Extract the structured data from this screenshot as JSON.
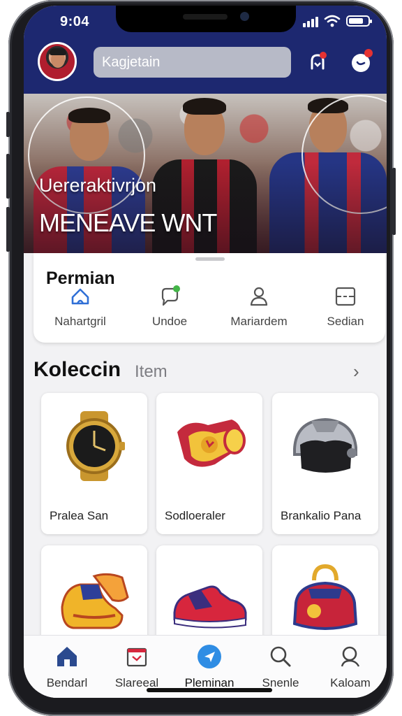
{
  "status": {
    "time": "9:04"
  },
  "header": {
    "search_value": "Kagjetain",
    "icons": [
      "avatar",
      "notification-icon",
      "chat-icon"
    ]
  },
  "hero": {
    "subtitle": "Uereraktivrjon",
    "title": "MENEAVE WNT"
  },
  "panel": {
    "title": "Permian",
    "items": [
      {
        "label": "Nahartgril",
        "icon": "home-outline-icon"
      },
      {
        "label": "Undoe",
        "icon": "chat-bubble-icon"
      },
      {
        "label": "Mariardem",
        "icon": "person-icon"
      },
      {
        "label": "Sedian",
        "icon": "ticket-icon"
      }
    ]
  },
  "collection": {
    "title": "Koleccin",
    "subtitle": "Item",
    "arrow": "›",
    "items": [
      {
        "label": "Pralea San",
        "icon": "watch-icon"
      },
      {
        "label": "Sodloeraler",
        "icon": "scroll-icon"
      },
      {
        "label": "Brankalio Pana",
        "icon": "helmet-icon"
      },
      {
        "label": "",
        "icon": "boots-icon"
      },
      {
        "label": "",
        "icon": "sneaker-icon"
      },
      {
        "label": "",
        "icon": "bag-icon"
      }
    ]
  },
  "tabbar": {
    "tabs": [
      {
        "label": "Bendarl",
        "icon": "home-icon"
      },
      {
        "label": "Slareeal",
        "icon": "calendar-icon"
      },
      {
        "label": "Pleminan",
        "icon": "play-icon",
        "active": true
      },
      {
        "label": "Snenle",
        "icon": "search-icon"
      },
      {
        "label": "Kaloam",
        "icon": "search-icon"
      }
    ]
  },
  "colors": {
    "header_bg": "#1d2870",
    "accent": "#2f8de4",
    "notification": "#e53232",
    "badge_green": "#43b548"
  }
}
